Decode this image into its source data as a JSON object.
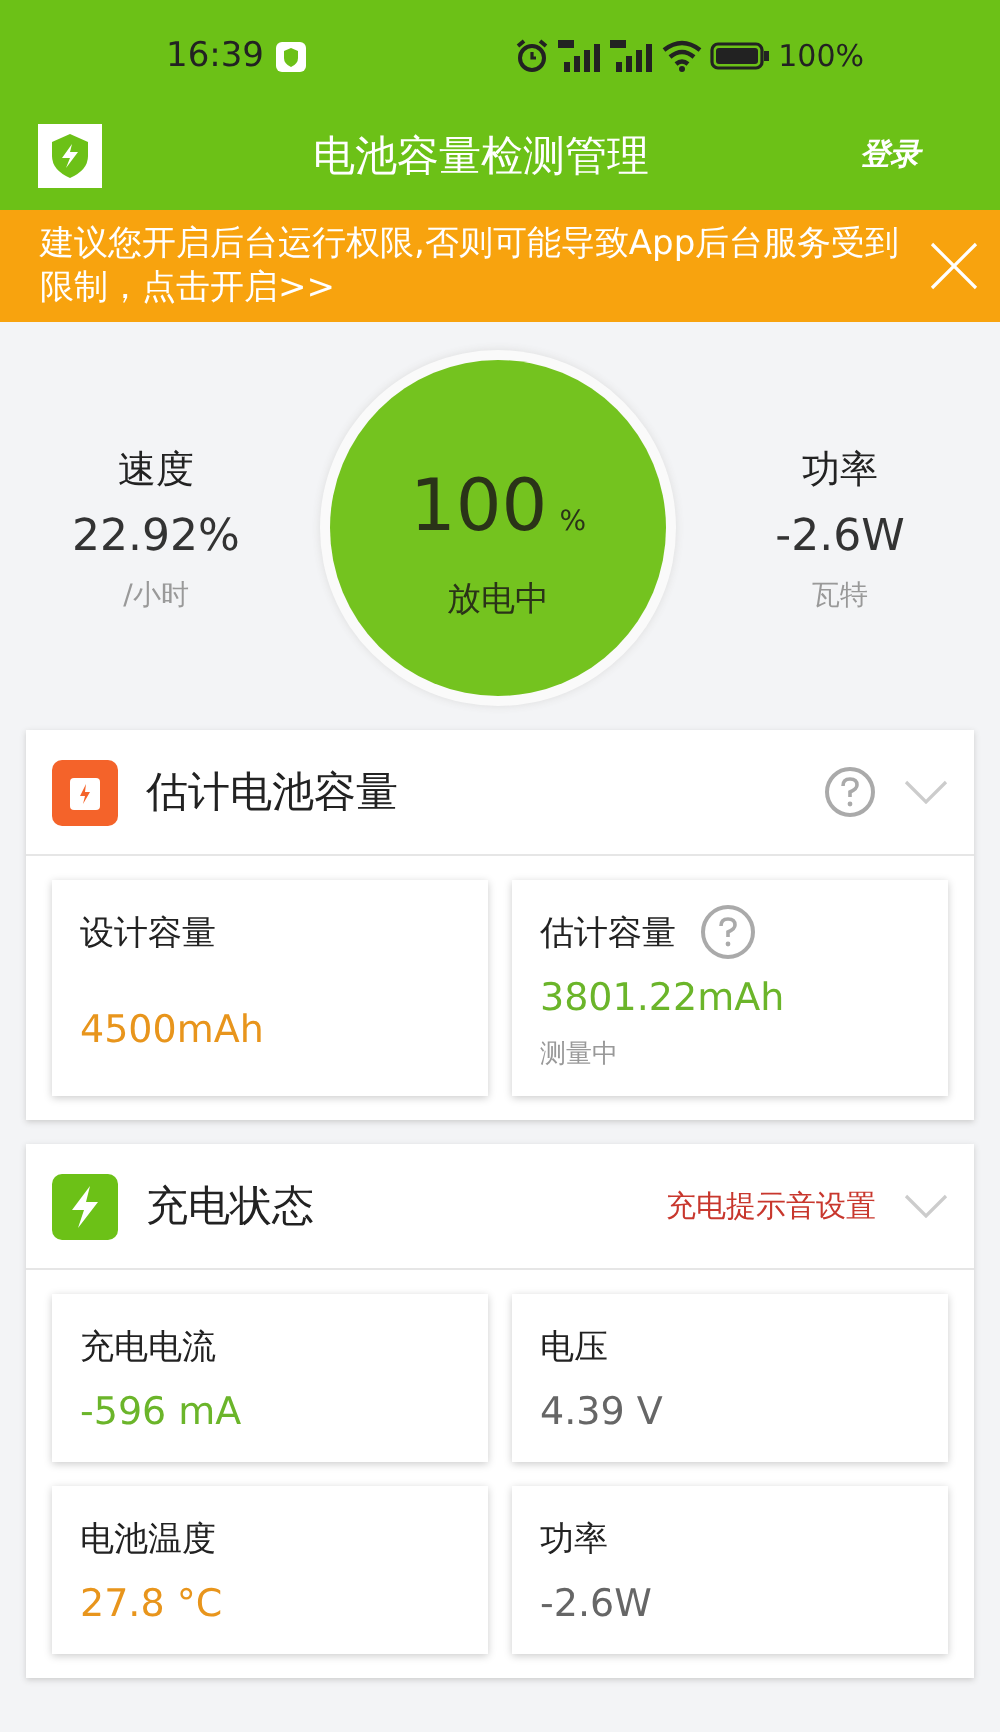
{
  "status_bar": {
    "time": "16:39",
    "battery": "100%"
  },
  "header": {
    "title": "电池容量检测管理",
    "login": "登录"
  },
  "banner": {
    "text": "建议您开启后台运行权限,否则可能导致App后台服务受到限制，点击开启>>"
  },
  "summary": {
    "left": {
      "label": "速度",
      "value": "22.92%",
      "unit": "/小时"
    },
    "gauge": {
      "value": "100",
      "unit": "%",
      "status": "放电中"
    },
    "right": {
      "label": "功率",
      "value": "-2.6W",
      "unit": "瓦特"
    }
  },
  "cards": [
    {
      "kind": "capacity",
      "title": "估计电池容量",
      "help": true,
      "expanded": false,
      "tiles": [
        {
          "label": "设计容量",
          "help": false,
          "value": "4500mAh",
          "color": "#e8951c"
        },
        {
          "label": "估计容量",
          "help": true,
          "value": "3801.22mAh",
          "color": "#6bb52a",
          "note": "测量中"
        }
      ]
    },
    {
      "kind": "charging",
      "title": "充电状态",
      "help": false,
      "link": "充电提示音设置",
      "expanded": false,
      "tiles": [
        {
          "label": "充电电流",
          "help": false,
          "value": "-596 mA",
          "color": "#6bb52a"
        },
        {
          "label": "电压",
          "help": false,
          "value": "4.39 V",
          "color": "#666666"
        },
        {
          "label": "电池温度",
          "help": false,
          "value": "27.8 °C",
          "color": "#e8951c"
        },
        {
          "label": "功率",
          "help": false,
          "value": "-2.6W",
          "color": "#666666"
        }
      ]
    }
  ]
}
